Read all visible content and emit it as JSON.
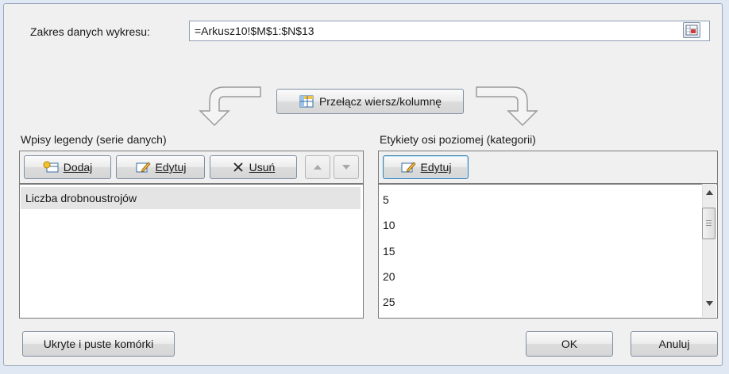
{
  "data_range": {
    "label": "Zakres danych wykresu:",
    "value": "=Arkusz10!$M$1:$N$13"
  },
  "switch_button": {
    "label": "Przełącz wiersz/kolumnę"
  },
  "legend": {
    "header": "Wpisy legendy (serie danych)",
    "add_label": "Dodaj",
    "edit_label": "Edytuj",
    "remove_label": "Usuń",
    "series": [
      "Liczba drobnoustrojów"
    ]
  },
  "categories": {
    "header": "Etykiety osi poziomej (kategorii)",
    "edit_label": "Edytuj",
    "items": [
      "5",
      "10",
      "15",
      "20",
      "25"
    ]
  },
  "footer": {
    "hidden_cells_label": "Ukryte i puste komórki",
    "ok_label": "OK",
    "cancel_label": "Anuluj"
  }
}
